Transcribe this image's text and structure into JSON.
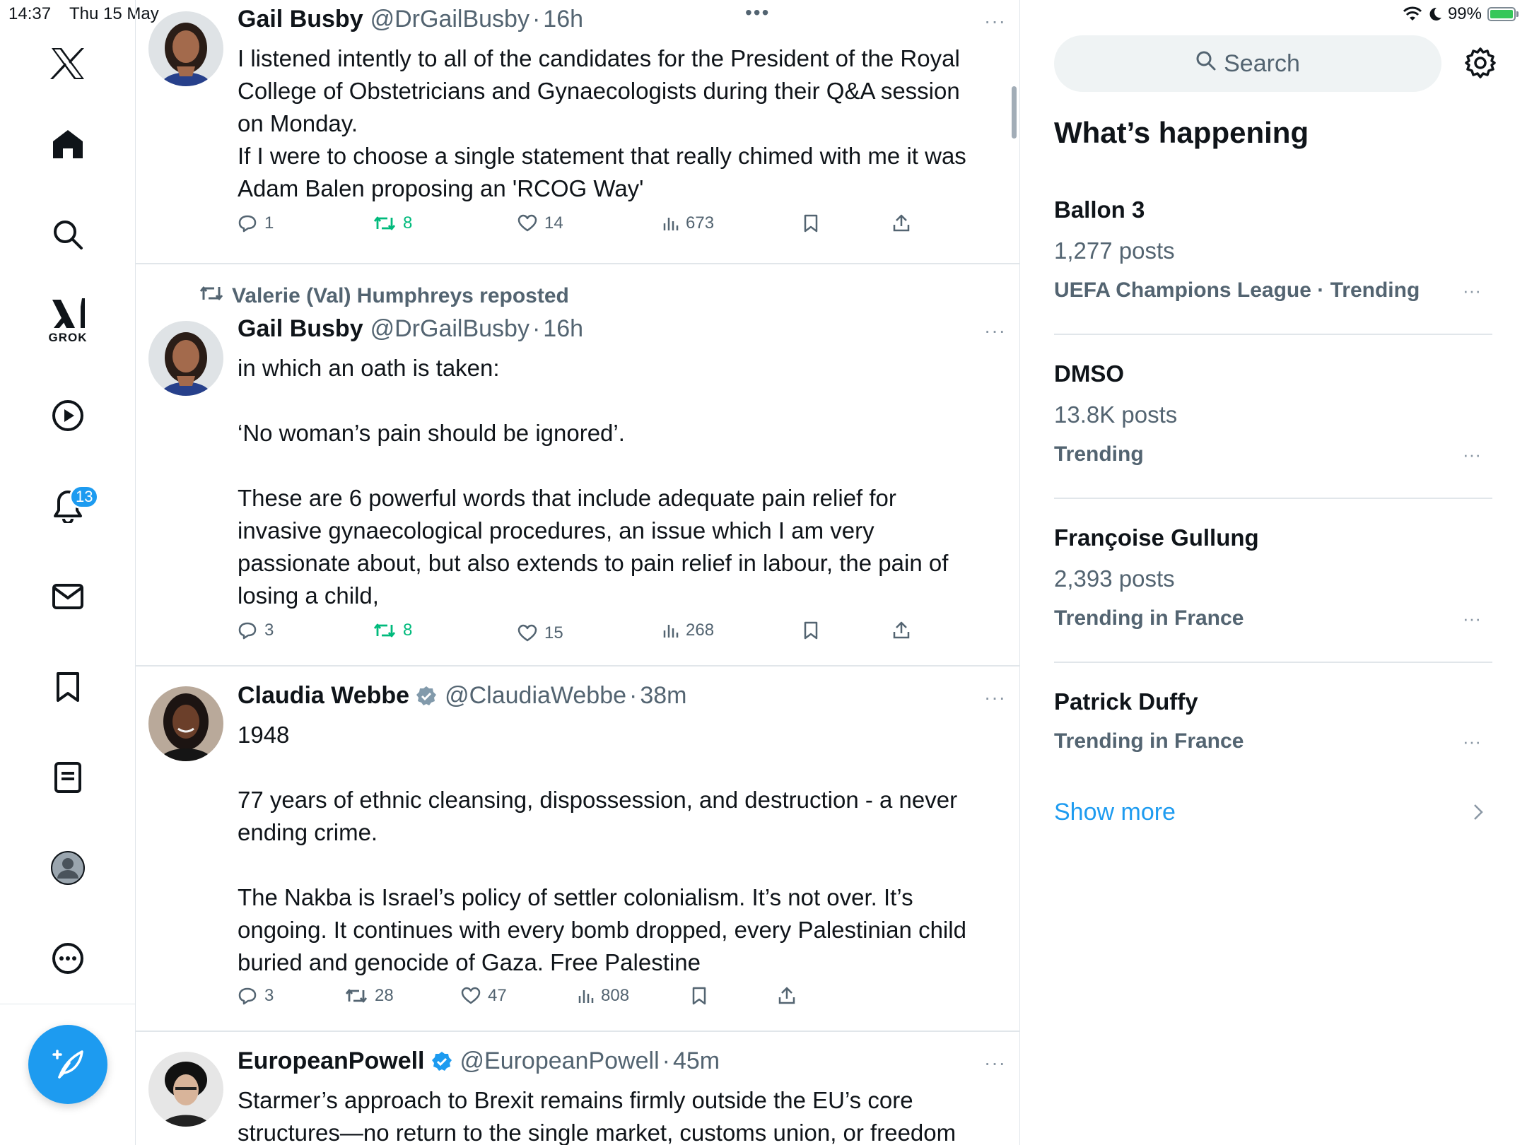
{
  "status_bar": {
    "time": "14:37",
    "date": "Thu 15 May",
    "battery": "99%"
  },
  "nav": {
    "grok_label": "GROK",
    "notifications_badge": "13"
  },
  "feed": {
    "tweets": [
      {
        "name": "Gail Busby",
        "handle": "@DrGailBusby",
        "sep": "·",
        "time": "16h",
        "more": "···",
        "lines": [
          "I listened intently to all of the candidates for the President of the Royal",
          "College of Obstetricians and Gynaecologists during their Q&A session",
          "on Monday.",
          "If I were to choose a single statement that really chimed with me it was",
          "Adam Balen proposing an 'RCOG Way'"
        ],
        "replies": "1",
        "reposts": "8",
        "likes": "14",
        "views": "673"
      },
      {
        "reposted_by": "Valerie (Val) Humphreys reposted",
        "name": "Gail Busby",
        "handle": "@DrGailBusby",
        "sep": "·",
        "time": "16h",
        "more": "···",
        "lines": [
          "in which an oath is taken:",
          "",
          "‘No woman’s pain should be ignored’.",
          "",
          "These are 6 powerful words that include adequate pain relief for",
          "invasive gynaecological procedures, an issue which I am very",
          "passionate about, but also extends to pain relief in labour, the pain of",
          "losing a child,"
        ],
        "replies": "3",
        "reposts": "8",
        "likes": "15",
        "views": "268"
      },
      {
        "name": "Claudia Webbe",
        "handle": "@ClaudiaWebbe",
        "sep": "·",
        "time": "38m",
        "more": "···",
        "lines": [
          "1948",
          "",
          "77 years of ethnic cleansing, dispossession, and destruction - a never",
          "ending crime.",
          "",
          "The Nakba is Israel’s policy of settler colonialism. It’s not over. It’s",
          "ongoing. It continues with every bomb dropped, every Palestinian child",
          "buried and genocide of Gaza. Free Palestine"
        ],
        "replies": "3",
        "reposts": "28",
        "likes": "47",
        "views": "808"
      },
      {
        "name": "EuropeanPowell",
        "handle": "@EuropeanPowell",
        "sep": "·",
        "time": "45m",
        "more": "···",
        "lines": [
          "Starmer’s approach to Brexit remains firmly outside the EU’s core",
          "structures—no return to the single market, customs union, or freedom"
        ]
      }
    ]
  },
  "sidebar": {
    "search_placeholder": "Search",
    "title": "What’s happening",
    "trends": [
      {
        "name": "Ballon 3",
        "count": "1,277 posts",
        "context": "UEFA Champions League · Trending"
      },
      {
        "name": "DMSO",
        "count": "13.8K posts",
        "context": "Trending"
      },
      {
        "name": "Françoise Gullung",
        "count": "2,393 posts",
        "context": "Trending in France"
      },
      {
        "name": "Patrick Duffy",
        "count": "",
        "context": "Trending in France"
      }
    ],
    "more_label": "···",
    "show_more": "Show more"
  },
  "colors": {
    "accent": "#1d9bf0",
    "repost_green": "#00ba7c",
    "muted": "#536471",
    "border": "#e1e6ea"
  }
}
